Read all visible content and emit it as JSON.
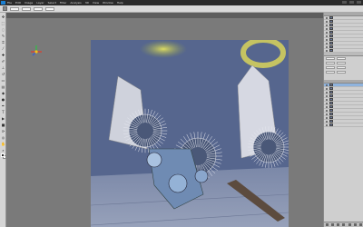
{
  "app": {
    "name": "Photoshop"
  },
  "menu": [
    "Ps",
    "File",
    "Edit",
    "Image",
    "Layer",
    "Select",
    "Filter",
    "Analysis",
    "3D",
    "View",
    "Window",
    "Help"
  ],
  "document": {
    "tab_title": ""
  },
  "colors": {
    "canvas_bg": "#5a6a90",
    "sky_glow_yellow": "#d9d65a",
    "selection_blue": "#8fb3dd",
    "accent_blue": "#1a7fd1"
  },
  "tools": [
    "move-tool",
    "marquee-tool",
    "lasso-tool",
    "quick-select-tool",
    "crop-tool",
    "eyedropper-tool",
    "spot-heal-tool",
    "brush-tool",
    "clone-stamp-tool",
    "history-brush-tool",
    "eraser-tool",
    "gradient-tool",
    "blur-tool",
    "dodge-tool",
    "pen-tool",
    "type-tool",
    "path-select-tool",
    "shape-tool",
    "3d-rotate-tool",
    "3d-camera-tool",
    "hand-tool",
    "zoom-tool"
  ],
  "layers": {
    "items": [
      {
        "name": ""
      },
      {
        "name": ""
      },
      {
        "name": ""
      },
      {
        "name": ""
      },
      {
        "name": ""
      },
      {
        "name": ""
      },
      {
        "name": ""
      },
      {
        "name": ""
      },
      {
        "name": ""
      },
      {
        "name": ""
      }
    ],
    "lower_items": [
      {
        "name": "",
        "selected": true
      },
      {
        "name": ""
      },
      {
        "name": ""
      },
      {
        "name": ""
      },
      {
        "name": ""
      },
      {
        "name": ""
      },
      {
        "name": ""
      },
      {
        "name": ""
      },
      {
        "name": ""
      },
      {
        "name": ""
      },
      {
        "name": ""
      },
      {
        "name": ""
      }
    ]
  }
}
